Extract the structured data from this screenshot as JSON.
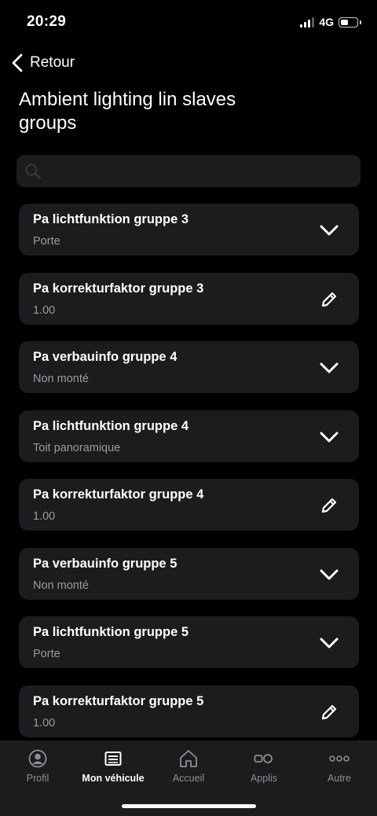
{
  "status_bar": {
    "time": "20:29",
    "network": "4G",
    "battery_level_percent": 45
  },
  "nav": {
    "back_label": "Retour"
  },
  "page": {
    "title": "Ambient lighting lin slaves groups"
  },
  "search": {
    "value": "",
    "placeholder": ""
  },
  "items": [
    {
      "title": "Pa lichtfunktion gruppe 3",
      "value": "Porte",
      "action": "chevron-down-icon"
    },
    {
      "title": "Pa korrekturfaktor gruppe 3",
      "value": "1.00",
      "action": "pencil-icon"
    },
    {
      "title": "Pa verbauinfo gruppe 4",
      "value": "Non monté",
      "action": "chevron-down-icon"
    },
    {
      "title": "Pa lichtfunktion gruppe 4",
      "value": "Toit panoramique",
      "action": "chevron-down-icon"
    },
    {
      "title": "Pa korrekturfaktor gruppe 4",
      "value": "1.00",
      "action": "pencil-icon"
    },
    {
      "title": "Pa verbauinfo gruppe 5",
      "value": "Non monté",
      "action": "chevron-down-icon"
    },
    {
      "title": "Pa lichtfunktion gruppe 5",
      "value": "Porte",
      "action": "chevron-down-icon"
    },
    {
      "title": "Pa korrekturfaktor gruppe 5",
      "value": "1.00",
      "action": "pencil-icon"
    }
  ],
  "tabbar": {
    "tabs": [
      {
        "label": "Profil",
        "icon": "profile-icon",
        "active": false
      },
      {
        "label": "Mon véhicule",
        "icon": "vehicle-list-icon",
        "active": true
      },
      {
        "label": "Accueil",
        "icon": "home-icon",
        "active": false
      },
      {
        "label": "Applis",
        "icon": "apps-icon",
        "active": false
      },
      {
        "label": "Autre",
        "icon": "more-icon",
        "active": false
      }
    ]
  },
  "colors": {
    "background": "#000000",
    "card": "#1c1c1e",
    "secondary_text": "#9b9b9f",
    "inactive_tab": "#8e8e93",
    "primary_text": "#ffffff"
  }
}
